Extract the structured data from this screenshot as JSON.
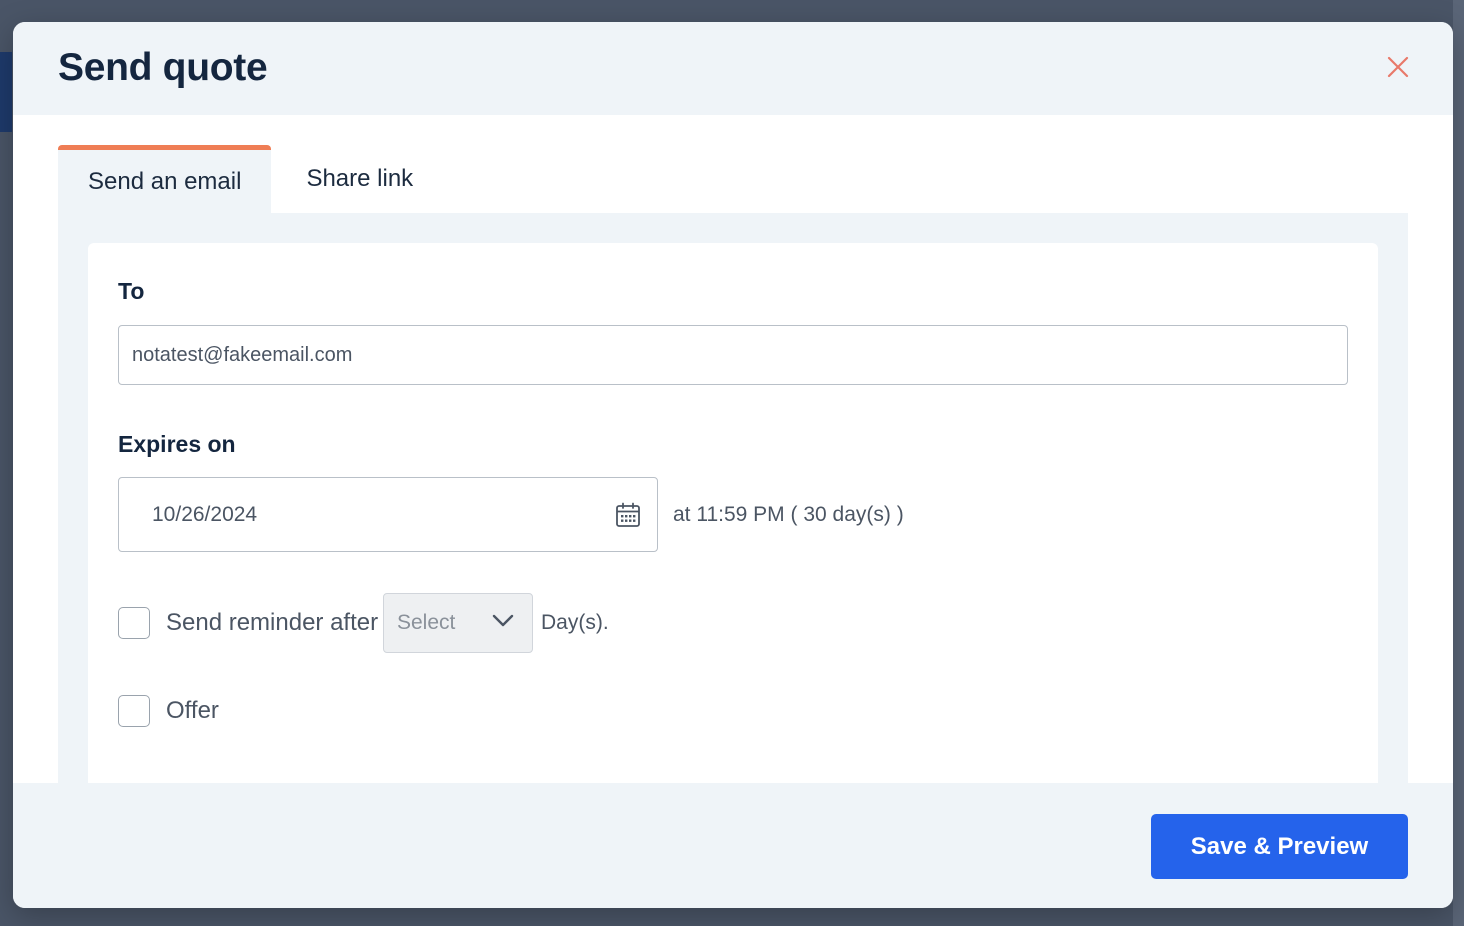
{
  "modal": {
    "title": "Send quote"
  },
  "tabs": [
    {
      "label": "Send an email",
      "active": true
    },
    {
      "label": "Share link",
      "active": false
    }
  ],
  "form": {
    "to_label": "To",
    "to_value": "notatest@fakeemail.com",
    "expires_label": "Expires on",
    "expires_date": "10/26/2024",
    "expires_note": "at 11:59 PM ( 30 day(s) )",
    "reminder_label": "Send reminder after",
    "reminder_select": "Select",
    "reminder_unit": "Day(s).",
    "offer_label": "Offer"
  },
  "footer": {
    "primary_label": "Save & Preview"
  },
  "icons": {
    "close": "close-icon",
    "calendar": "calendar-icon",
    "chevron": "chevron-down-icon"
  },
  "colors": {
    "accent_tab": "#ef7d55",
    "primary_button": "#2563eb",
    "close_icon": "#e8796a",
    "title": "#14263f"
  }
}
